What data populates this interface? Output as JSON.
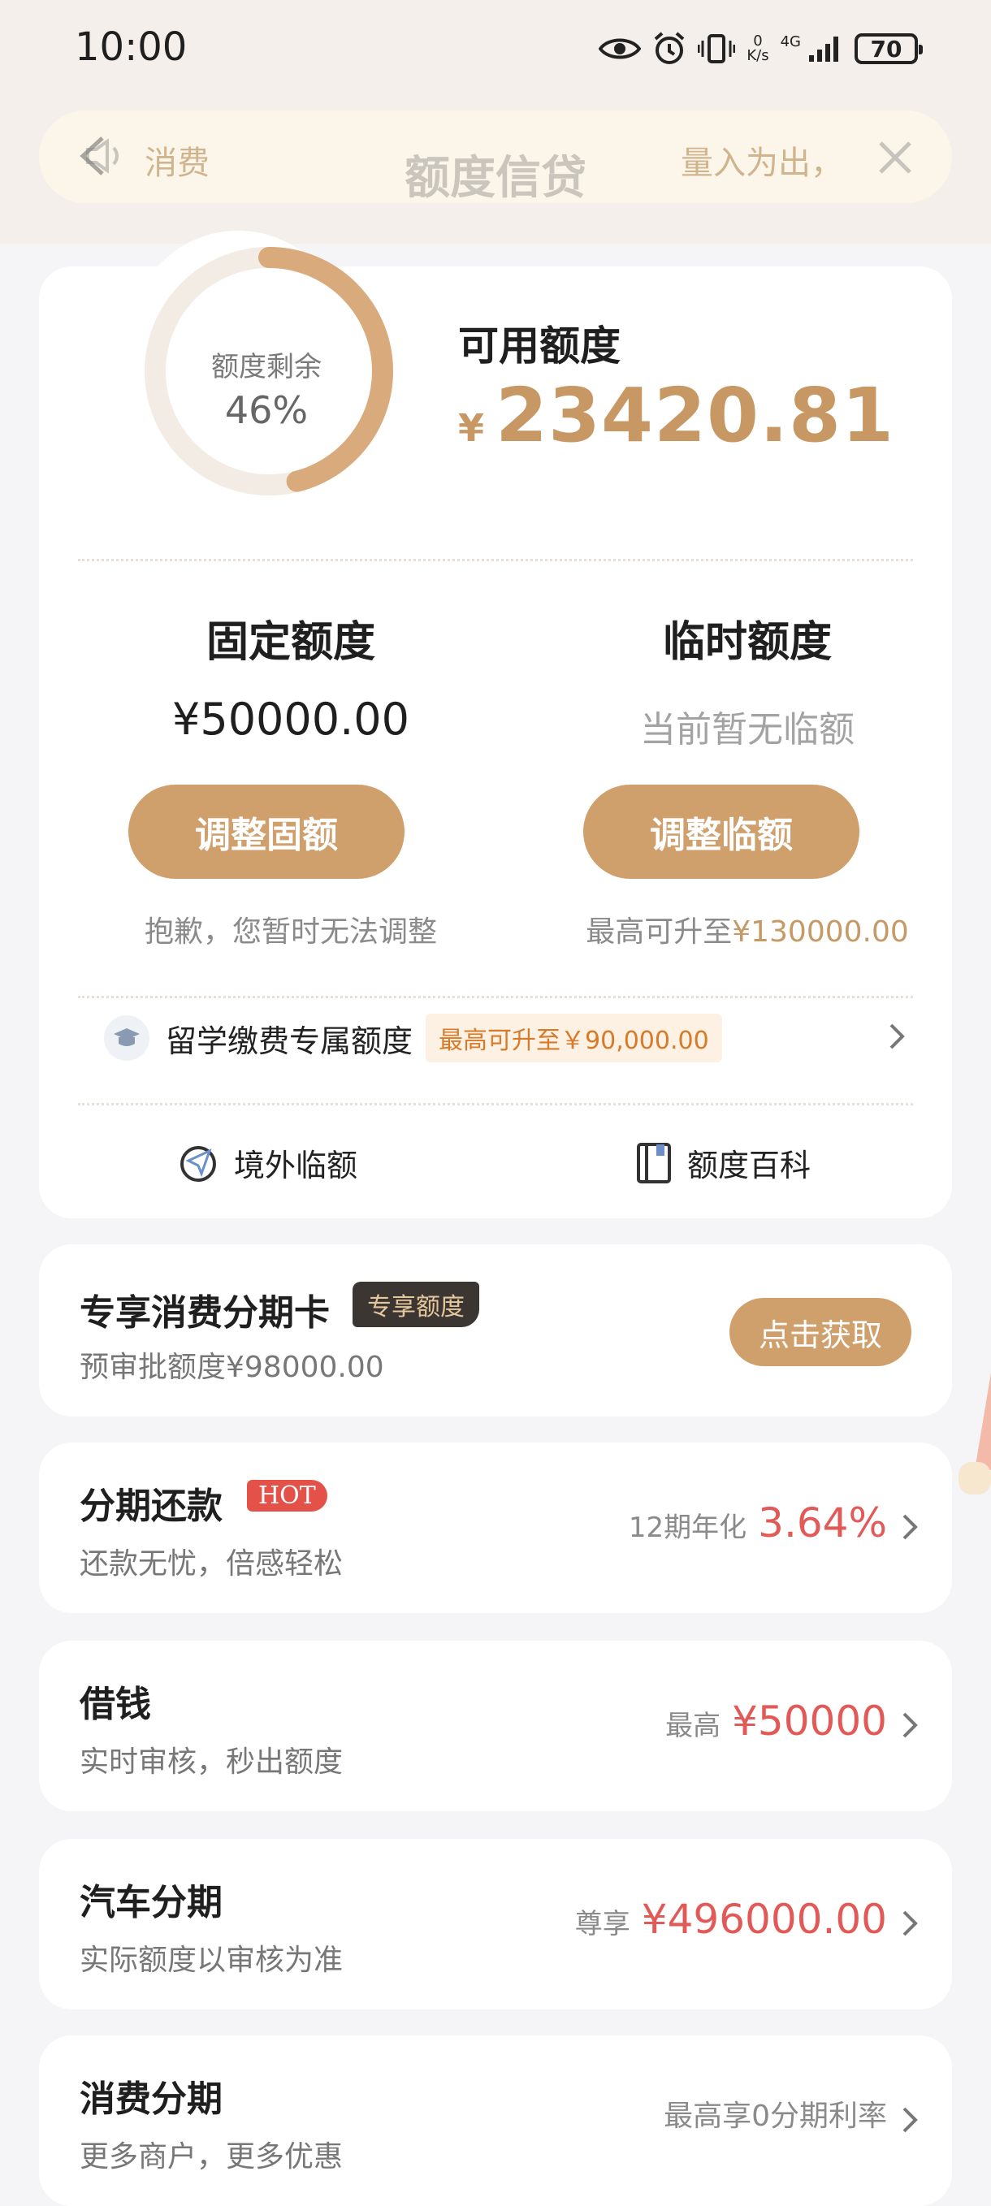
{
  "status_bar": {
    "time": "10:00",
    "speed_value": "0",
    "speed_unit": "K/s",
    "network": "4G",
    "battery": "70"
  },
  "notice_bar": {
    "left_text": "消费",
    "title": "额度信贷",
    "right_text": "量入为出，"
  },
  "credit": {
    "ring_label": "额度剩余",
    "ring_percent": "46%",
    "remaining_fraction": 0.46,
    "available_label": "可用额度",
    "available_currency": "¥",
    "available_amount": "23420.81"
  },
  "fixed": {
    "title": "固定额度",
    "value": "¥50000.00",
    "button": "调整固额",
    "note": "抱歉，您暂时无法调整"
  },
  "temporary": {
    "title": "临时额度",
    "value": "当前暂无临额",
    "button": "调整临额",
    "note_prefix": "最高可升至",
    "note_amount": "¥130000.00"
  },
  "study_abroad": {
    "label": "留学缴费专属额度",
    "tag": "最高可升至￥90,000.00"
  },
  "links": {
    "overseas": "境外临额",
    "wiki": "额度百科"
  },
  "installment_card": {
    "title": "专享消费分期卡",
    "badge": "专享额度",
    "subtitle": "预审批额度¥98000.00",
    "button": "点击获取"
  },
  "rows": [
    {
      "title": "分期还款",
      "badge": "HOT",
      "subtitle": "还款无忧，倍感轻松",
      "prefix": "12期年化",
      "value": "3.64%"
    },
    {
      "title": "借钱",
      "subtitle": "实时审核，秒出额度",
      "prefix": "最高",
      "value": "¥50000"
    },
    {
      "title": "汽车分期",
      "subtitle": "实际额度以审核为准",
      "prefix": "尊享",
      "value": "¥496000.00"
    },
    {
      "title": "消费分期",
      "subtitle": "更多商户，更多优惠",
      "plain": "最高享0分期利率"
    }
  ],
  "colors": {
    "gold": "#cf9f6c",
    "gold_text": "#c79863",
    "red": "#e25a57",
    "ring_track": "#f3ece5"
  }
}
